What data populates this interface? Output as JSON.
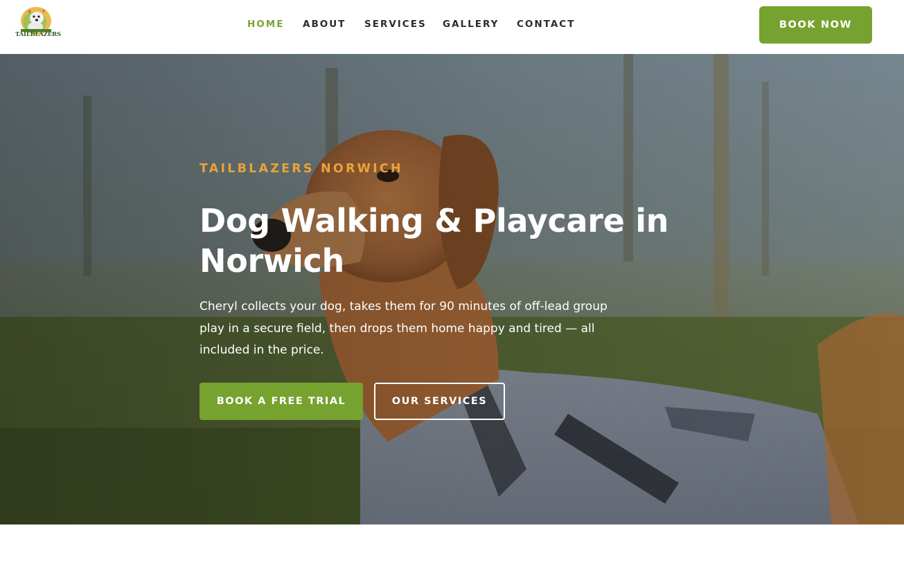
{
  "header": {
    "logo_text": "TAILBLAZERS",
    "nav": [
      {
        "label": "HOME",
        "active": true
      },
      {
        "label": "ABOUT",
        "active": false
      },
      {
        "label": "SERVICES",
        "active": false
      },
      {
        "label": "GALLERY",
        "active": false
      },
      {
        "label": "CONTACT",
        "active": false
      }
    ],
    "book_button": "BOOK NOW"
  },
  "hero": {
    "eyebrow": "TAILBLAZERS NORWICH",
    "headline": "Dog Walking & Playcare in Norwich",
    "lead": "Cheryl collects your dog, takes them for 90 minutes of off-lead group play in a secure field, then drops them home happy and tired — all included in the price.",
    "primary_cta": "BOOK A FREE TRIAL",
    "secondary_cta": "OUR SERVICES",
    "image": "dog-in-field-photo"
  },
  "colors": {
    "brand_green": "#76a22f",
    "nav_active": "#7aa432",
    "eyebrow_orange": "#e8a33a",
    "nav_text": "#2b2b2b"
  }
}
